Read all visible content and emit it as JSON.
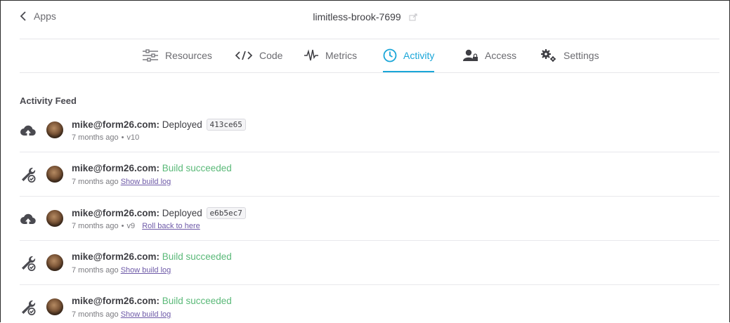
{
  "header": {
    "back_label": "Apps",
    "app_name": "limitless-brook-7699"
  },
  "tabs": [
    {
      "label": "Resources",
      "icon": "resources-icon"
    },
    {
      "label": "Code",
      "icon": "code-icon"
    },
    {
      "label": "Metrics",
      "icon": "metrics-icon"
    },
    {
      "label": "Activity",
      "icon": "clock-icon",
      "active": true
    },
    {
      "label": "Access",
      "icon": "access-icon"
    },
    {
      "label": "Settings",
      "icon": "gears-icon"
    }
  ],
  "feed": {
    "title": "Activity Feed",
    "items": [
      {
        "type": "deploy",
        "user": "mike@form26.com:",
        "action": "Deployed",
        "sha": "413ce65",
        "time": "7 months ago",
        "version": "v10",
        "link": ""
      },
      {
        "type": "build",
        "user": "mike@form26.com:",
        "action": "Build succeeded",
        "time": "7 months ago",
        "link": "Show build log"
      },
      {
        "type": "deploy",
        "user": "mike@form26.com:",
        "action": "Deployed",
        "sha": "e6b5ec7",
        "time": "7 months ago",
        "version": "v9",
        "link": "Roll back to here"
      },
      {
        "type": "build",
        "user": "mike@form26.com:",
        "action": "Build succeeded",
        "time": "7 months ago",
        "link": "Show build log"
      },
      {
        "type": "build",
        "user": "mike@form26.com:",
        "action": "Build succeeded",
        "time": "7 months ago",
        "link": "Show build log"
      }
    ]
  },
  "colors": {
    "accent": "#1aa6d8",
    "success": "#5ab978",
    "link": "#6e5aa8"
  }
}
